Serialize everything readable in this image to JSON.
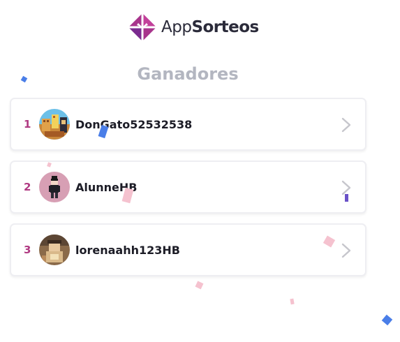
{
  "brand": {
    "app": "App",
    "sorteos": "Sorteos",
    "logo_icon": "gift-diamond-logo-icon"
  },
  "heading": "Ganadores",
  "colors": {
    "accent": "#b03a82",
    "logo_primary": "#a8348c",
    "logo_secondary": "#7a2b8f",
    "heading": "#b3b6c0",
    "chevron": "#c6c6cc"
  },
  "winners": [
    {
      "rank": "1",
      "username": "DonGato52532538",
      "avatar_icon": "user-avatar-icon"
    },
    {
      "rank": "2",
      "username": "AlunneHB",
      "avatar_icon": "user-avatar-icon"
    },
    {
      "rank": "3",
      "username": "lorenaahh123HB",
      "avatar_icon": "user-avatar-icon"
    }
  ],
  "row_action_icon": "chevron-right-icon"
}
